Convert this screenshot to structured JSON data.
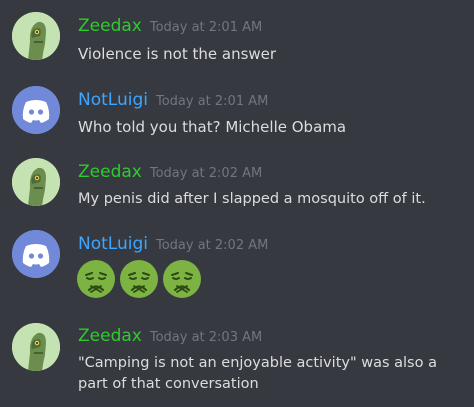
{
  "colors": {
    "background": "#36393f",
    "zeedax_name": "#2ecc2e",
    "notluigi_name": "#3ea6ff",
    "timestamp": "#72767d",
    "text": "#dcddde",
    "blurple": "#7289da",
    "nauseated_face": "#7cb342"
  },
  "messages": [
    {
      "author": "Zeedax",
      "timestamp": "Today at 2:01 AM",
      "text": "Violence is not the answer",
      "avatar_icon": "zeedax-avatar-icon"
    },
    {
      "author": "NotLuigi",
      "timestamp": "Today at 2:01 AM",
      "text": "Who told you that? Michelle Obama",
      "avatar_icon": "discord-logo-icon"
    },
    {
      "author": "Zeedax",
      "timestamp": "Today at 2:02 AM",
      "text": "My penis did after I slapped a mosquito off of it.",
      "avatar_icon": "zeedax-avatar-icon"
    },
    {
      "author": "NotLuigi",
      "timestamp": "Today at 2:02 AM",
      "emojis": [
        "nauseated-face-icon",
        "nauseated-face-icon",
        "nauseated-face-icon"
      ],
      "avatar_icon": "discord-logo-icon"
    },
    {
      "author": "Zeedax",
      "timestamp": "Today at 2:03 AM",
      "text": "\"Camping is not an enjoyable activity\" was also a part of that conversation",
      "avatar_icon": "zeedax-avatar-icon"
    }
  ]
}
